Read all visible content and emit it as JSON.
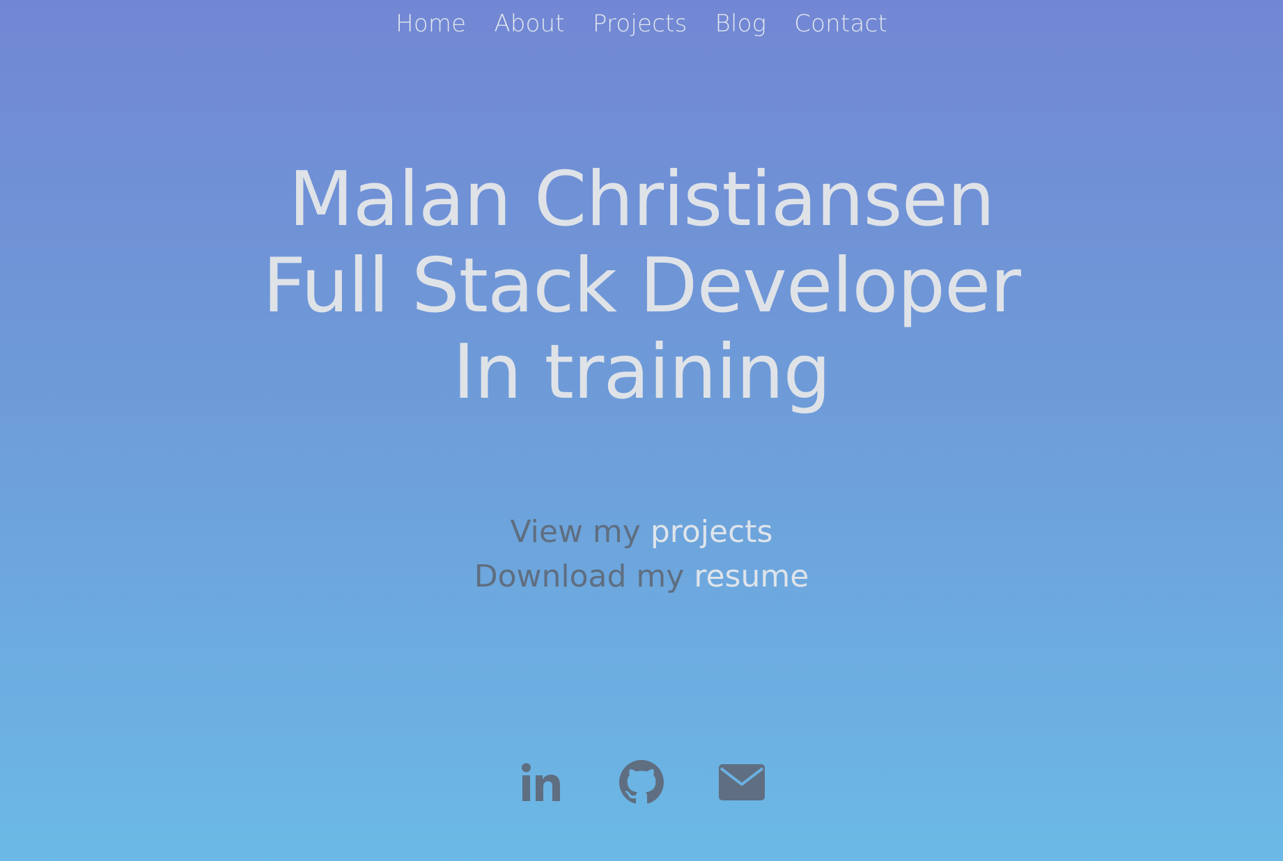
{
  "nav": {
    "items": [
      {
        "label": "Home"
      },
      {
        "label": "About"
      },
      {
        "label": "Projects"
      },
      {
        "label": "Blog"
      },
      {
        "label": "Contact"
      }
    ]
  },
  "hero": {
    "name": "Malan Christiansen",
    "role": "Full Stack Developer",
    "status": "In training"
  },
  "cta": {
    "projects_prefix": "View my ",
    "projects_link": "projects",
    "resume_prefix": "Download my ",
    "resume_link": "resume"
  },
  "social": {
    "icons": [
      "linkedin-icon",
      "github-icon",
      "email-icon"
    ]
  },
  "colors": {
    "gradient_top": "#7287d4",
    "gradient_bottom": "#6bb9e6",
    "text_light": "#dfe3e8",
    "text_muted": "#5f6e80",
    "icon": "#5f6e80"
  }
}
